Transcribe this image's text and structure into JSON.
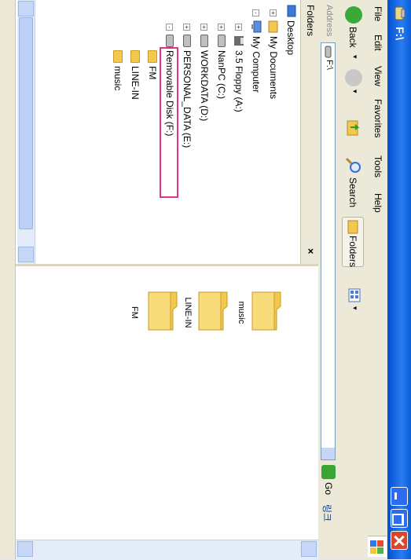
{
  "window": {
    "title": "F:\\"
  },
  "menu": [
    "File",
    "Edit",
    "View",
    "Favorites",
    "Tools",
    "Help"
  ],
  "toolbar": {
    "back_label": "Back",
    "search_label": "Search",
    "folders_label": "Folders"
  },
  "address": {
    "label": "Address",
    "value": "F:\\",
    "go_label": "Go",
    "links_label": "링크"
  },
  "folders_pane": {
    "header": "Folders",
    "close_glyph": "×",
    "tree": [
      {
        "label": "Desktop",
        "level": 0,
        "icon": "desktop-icon",
        "expander": ""
      },
      {
        "label": "My Documents",
        "level": 1,
        "icon": "my-documents-icon",
        "expander": "+"
      },
      {
        "label": "My Computer",
        "level": 1,
        "icon": "my-computer-icon",
        "expander": "-"
      },
      {
        "label": "3.5 Floppy (A:)",
        "level": 2,
        "icon": "floppy-drive-icon",
        "expander": "+"
      },
      {
        "label": "NanPC (C:)",
        "level": 2,
        "icon": "hard-drive-icon",
        "expander": "+"
      },
      {
        "label": "WORKDATA (D:)",
        "level": 2,
        "icon": "hard-drive-icon",
        "expander": "+"
      },
      {
        "label": "PERSONAL_DATA (E:)",
        "level": 2,
        "icon": "hard-drive-icon",
        "expander": "+"
      },
      {
        "label": "Removable Disk (F:)",
        "level": 2,
        "icon": "removable-disk-icon",
        "expander": "-"
      },
      {
        "label": "FM",
        "level": 3,
        "icon": "folder-icon",
        "expander": ""
      },
      {
        "label": "LINE-IN",
        "level": 3,
        "icon": "folder-icon",
        "expander": ""
      },
      {
        "label": "music",
        "level": 3,
        "icon": "folder-icon",
        "expander": ""
      }
    ]
  },
  "content": {
    "folders": [
      {
        "label": "FM"
      },
      {
        "label": "LINE-IN"
      },
      {
        "label": "music"
      }
    ]
  },
  "colors": {
    "titlebar": "#0a5fd8",
    "highlight": "#e0328a",
    "folder_yellow": "#f2c94c"
  }
}
